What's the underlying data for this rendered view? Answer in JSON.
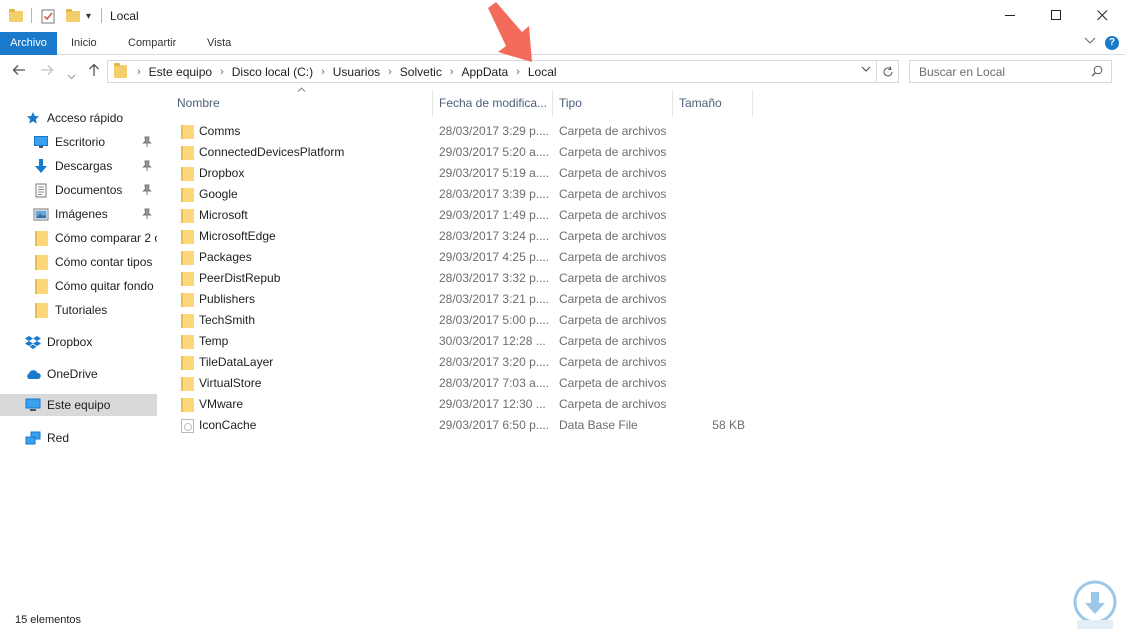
{
  "window": {
    "title": "Local",
    "controls": {
      "minimize": "—",
      "maximize": "☐",
      "close": "✕"
    }
  },
  "ribbon": {
    "tabs": [
      "Archivo",
      "Inicio",
      "Compartir",
      "Vista"
    ],
    "help": "?"
  },
  "address": {
    "breadcrumbs": [
      "Este equipo",
      "Disco local (C:)",
      "Usuarios",
      "Solvetic",
      "AppData",
      "Local"
    ]
  },
  "search": {
    "placeholder": "Buscar en Local"
  },
  "navpane": {
    "quick_access": "Acceso rápido",
    "pinned": [
      "Escritorio",
      "Descargas",
      "Documentos",
      "Imágenes"
    ],
    "recent": [
      "Cómo comparar 2 c",
      "Cómo contar tipos",
      "Cómo quitar fondo",
      "Tutoriales"
    ],
    "dropbox": "Dropbox",
    "onedrive": "OneDrive",
    "this_pc": "Este equipo",
    "network": "Red"
  },
  "columns": {
    "name": "Nombre",
    "date": "Fecha de modifica...",
    "type": "Tipo",
    "size": "Tamaño"
  },
  "files": [
    {
      "name": "Comms",
      "date": "28/03/2017 3:29 p....",
      "type": "Carpeta de archivos",
      "size": "",
      "kind": "folder"
    },
    {
      "name": "ConnectedDevicesPlatform",
      "date": "29/03/2017 5:20 a....",
      "type": "Carpeta de archivos",
      "size": "",
      "kind": "folder"
    },
    {
      "name": "Dropbox",
      "date": "29/03/2017 5:19 a....",
      "type": "Carpeta de archivos",
      "size": "",
      "kind": "folder"
    },
    {
      "name": "Google",
      "date": "28/03/2017 3:39 p....",
      "type": "Carpeta de archivos",
      "size": "",
      "kind": "folder"
    },
    {
      "name": "Microsoft",
      "date": "29/03/2017 1:49 p....",
      "type": "Carpeta de archivos",
      "size": "",
      "kind": "folder"
    },
    {
      "name": "MicrosoftEdge",
      "date": "28/03/2017 3:24 p....",
      "type": "Carpeta de archivos",
      "size": "",
      "kind": "folder"
    },
    {
      "name": "Packages",
      "date": "29/03/2017 4:25 p....",
      "type": "Carpeta de archivos",
      "size": "",
      "kind": "folder"
    },
    {
      "name": "PeerDistRepub",
      "date": "28/03/2017 3:32 p....",
      "type": "Carpeta de archivos",
      "size": "",
      "kind": "folder"
    },
    {
      "name": "Publishers",
      "date": "28/03/2017 3:21 p....",
      "type": "Carpeta de archivos",
      "size": "",
      "kind": "folder"
    },
    {
      "name": "TechSmith",
      "date": "28/03/2017 5:00 p....",
      "type": "Carpeta de archivos",
      "size": "",
      "kind": "folder"
    },
    {
      "name": "Temp",
      "date": "30/03/2017 12:28 ...",
      "type": "Carpeta de archivos",
      "size": "",
      "kind": "folder"
    },
    {
      "name": "TileDataLayer",
      "date": "28/03/2017 3:20 p....",
      "type": "Carpeta de archivos",
      "size": "",
      "kind": "folder"
    },
    {
      "name": "VirtualStore",
      "date": "28/03/2017 7:03 a....",
      "type": "Carpeta de archivos",
      "size": "",
      "kind": "folder"
    },
    {
      "name": "VMware",
      "date": "29/03/2017 12:30 ...",
      "type": "Carpeta de archivos",
      "size": "",
      "kind": "folder"
    },
    {
      "name": "IconCache",
      "date": "29/03/2017 6:50 p....",
      "type": "Data Base File",
      "size": "58 KB",
      "kind": "file"
    }
  ],
  "status": {
    "count": "15 elementos"
  },
  "colors": {
    "accent": "#1979ca",
    "arrow": "#f26b5b",
    "selected": "#d9d9d9",
    "folder": "#fcd87a"
  }
}
